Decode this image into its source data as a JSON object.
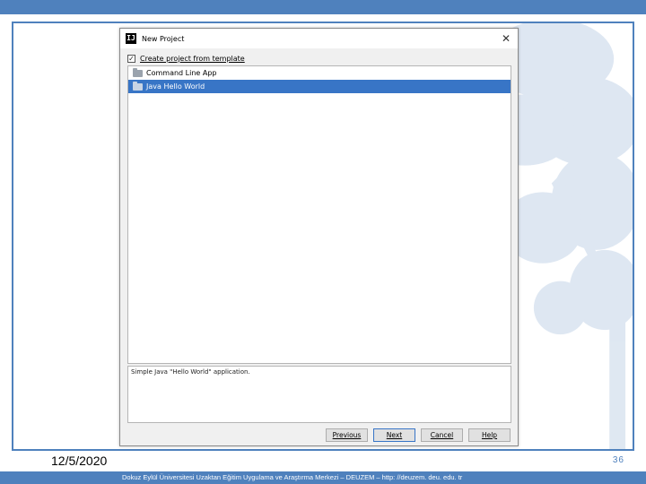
{
  "dialog": {
    "title": "New Project",
    "close_glyph": "✕",
    "app_icon_glyph": "IJ",
    "template_checkbox": {
      "label": "Create project from template",
      "checked": true,
      "check_glyph": "✓"
    },
    "templates": [
      {
        "label": "Command Line App",
        "selected": false
      },
      {
        "label": "Java Hello World",
        "selected": true
      }
    ],
    "description": "Simple Java \"Hello World\" application.",
    "buttons": {
      "previous": "Previous",
      "next": "Next",
      "cancel": "Cancel",
      "help": "Help"
    }
  },
  "slide": {
    "date": "12/5/2020",
    "page_number": "36",
    "footer": "Dokuz Eylül Üniversitesi Uzaktan Eğitim Uygulama ve Araştırma Merkezi – DEUZEM – http: //deuzem. deu. edu. tr"
  },
  "colors": {
    "accent": "#4f81bd",
    "selection": "#3875c6"
  }
}
